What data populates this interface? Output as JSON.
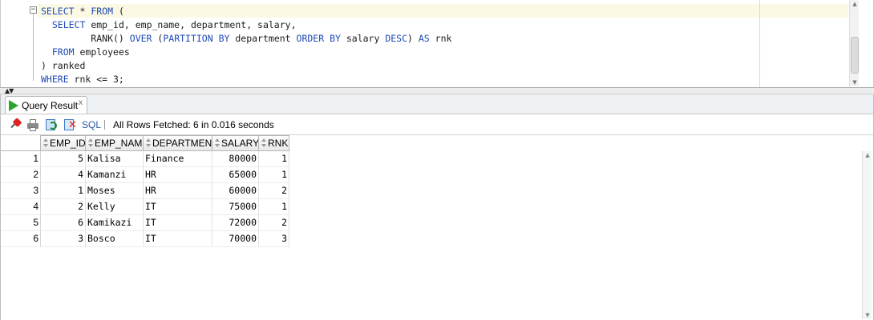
{
  "editor": {
    "lines": [
      [
        {
          "t": "SELECT",
          "c": "kw"
        },
        {
          "t": " * "
        },
        {
          "t": "FROM",
          "c": "kw"
        },
        {
          "t": " ("
        }
      ],
      [
        {
          "t": "  "
        },
        {
          "t": "SELECT",
          "c": "kw"
        },
        {
          "t": " emp_id, emp_name, department, salary,"
        }
      ],
      [
        {
          "t": "         RANK() "
        },
        {
          "t": "OVER",
          "c": "kw"
        },
        {
          "t": " ("
        },
        {
          "t": "PARTITION BY",
          "c": "kw"
        },
        {
          "t": " department "
        },
        {
          "t": "ORDER BY",
          "c": "kw"
        },
        {
          "t": " salary "
        },
        {
          "t": "DESC",
          "c": "kw"
        },
        {
          "t": ") "
        },
        {
          "t": "AS",
          "c": "kw"
        },
        {
          "t": " rnk"
        }
      ],
      [
        {
          "t": "  "
        },
        {
          "t": "FROM",
          "c": "kw"
        },
        {
          "t": " employees"
        }
      ],
      [
        {
          "t": ") ranked"
        }
      ],
      [
        {
          "t": "WHERE",
          "c": "kw"
        },
        {
          "t": " rnk <= 3;"
        }
      ]
    ],
    "fold_glyph": "−"
  },
  "splitter": {
    "arrows": "▲▼"
  },
  "result_tab": {
    "label": "Query Result",
    "close": "x"
  },
  "toolbar": {
    "sql_label": "SQL",
    "separator": "|",
    "status": "All Rows Fetched: 6 in 0.016 seconds"
  },
  "grid": {
    "columns": [
      "EMP_ID",
      "EMP_NAME",
      "DEPARTMENT",
      "SALARY",
      "RNK"
    ],
    "rows": [
      {
        "rownum": "1",
        "emp_id": "5",
        "emp_name": "Kalisa",
        "department": "Finance",
        "salary": "80000",
        "rnk": "1"
      },
      {
        "rownum": "2",
        "emp_id": "4",
        "emp_name": "Kamanzi",
        "department": "HR",
        "salary": "65000",
        "rnk": "1"
      },
      {
        "rownum": "3",
        "emp_id": "1",
        "emp_name": "Moses",
        "department": "HR",
        "salary": "60000",
        "rnk": "2"
      },
      {
        "rownum": "4",
        "emp_id": "2",
        "emp_name": "Kelly",
        "department": "IT",
        "salary": "75000",
        "rnk": "1"
      },
      {
        "rownum": "5",
        "emp_id": "6",
        "emp_name": "Kamikazi",
        "department": "IT",
        "salary": "72000",
        "rnk": "2"
      },
      {
        "rownum": "6",
        "emp_id": "3",
        "emp_name": "Bosco",
        "department": "IT",
        "salary": "70000",
        "rnk": "3"
      }
    ]
  },
  "colors": {
    "keyword": "#1f4bb5",
    "current_line": "#fbf8e4",
    "run_icon": "#2aa52a",
    "sql_link": "#2457a8"
  }
}
